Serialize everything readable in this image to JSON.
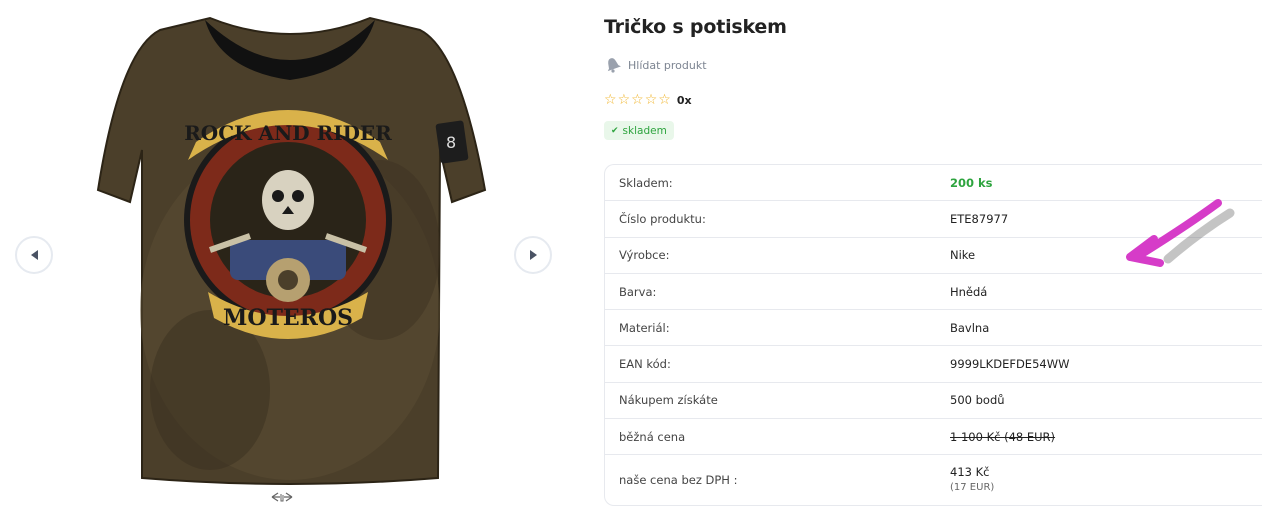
{
  "product": {
    "title": "Tričko s potiskem",
    "watch_label": "Hlídat produkt",
    "rating_count": "0x",
    "stars": 5,
    "stock_badge": "skladem",
    "shirt_print_top": "ROCK AND RIDER",
    "shirt_print_bottom": "MOTEROS"
  },
  "params": [
    {
      "label": "Skladem:",
      "value": "200 ks"
    },
    {
      "label": "Číslo produktu:",
      "value": "ETE87977"
    },
    {
      "label": "Výrobce:",
      "value": "Nike"
    },
    {
      "label": "Barva:",
      "value": "Hnědá"
    },
    {
      "label": "Materiál:",
      "value": "Bavlna"
    },
    {
      "label": "EAN kód:",
      "value": "9999LKDEFDE54WW"
    },
    {
      "label": "Nákupem získáte",
      "value": "500 bodů"
    },
    {
      "label": "běžná cena",
      "value": "1 100 Kč (48 EUR)"
    },
    {
      "label": "naše cena bez DPH :",
      "value": "413 Kč",
      "sub": "(17 EUR)"
    }
  ],
  "colors": {
    "accent_green": "#2ea43f",
    "star": "#f0b429",
    "annotation_arrow": "#d63cc8"
  },
  "icons": {
    "watch": "bell-icon",
    "prev": "chevron-left-icon",
    "next": "chevron-right-icon",
    "stock": "check-icon",
    "swipe": "swipe-icon"
  }
}
